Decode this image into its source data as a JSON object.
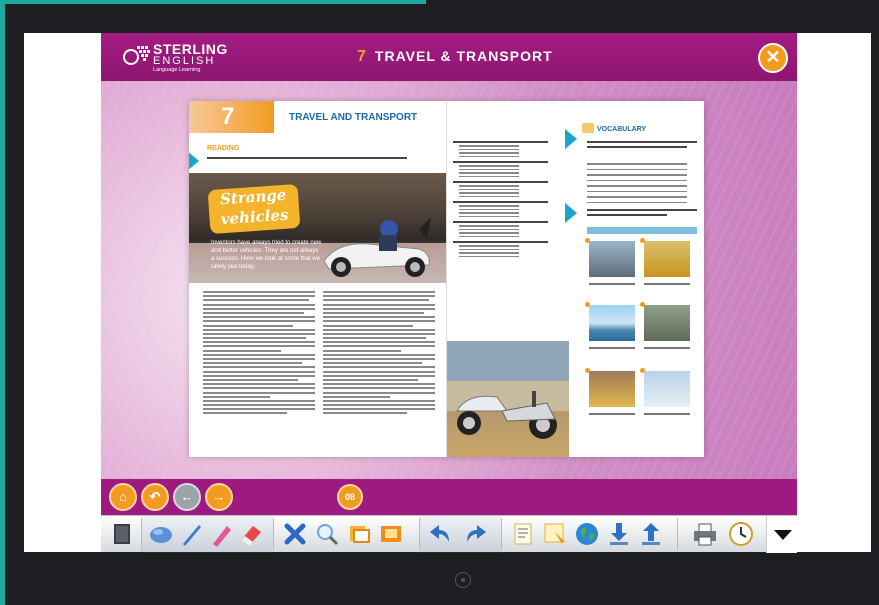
{
  "app": {
    "logo": {
      "line1": "STERLING",
      "line2": "ENGLISH",
      "line3": "Language Learning"
    },
    "header": {
      "unit_number": "7",
      "title": "TRAVEL & TRANSPORT"
    },
    "close_symbol": "✕"
  },
  "book": {
    "left_page": {
      "unit_number": "7",
      "unit_title": "TRAVEL AND TRANSPORT",
      "section": "READING",
      "feature_title_1": "Strange",
      "feature_title_2": "vehicles",
      "caption": "Inventors have always tried to create new and better vehicles. They are not always a success. Here we look at some that we rarely see today."
    },
    "right_page": {
      "section": "VOCABULARY"
    }
  },
  "nav": {
    "home": "⌂",
    "back": "↶",
    "prev": "←",
    "next": "→",
    "page": "08"
  },
  "toolbar": {
    "icons": [
      "book-icon",
      "mouse-icon",
      "pen-icon",
      "highlighter-icon",
      "eraser-icon",
      "clear-icon",
      "zoom-icon",
      "rectangle-icon",
      "spotlight-icon",
      "undo-icon",
      "redo-icon",
      "note-icon",
      "pointer-icon",
      "globe-icon",
      "download-icon",
      "upload-icon",
      "print-icon",
      "clock-icon"
    ]
  },
  "colors": {
    "header": "#a51b84",
    "accent": "#f29b21",
    "book_blue": "#1e6aa8",
    "teal": "#1fa7a0"
  }
}
